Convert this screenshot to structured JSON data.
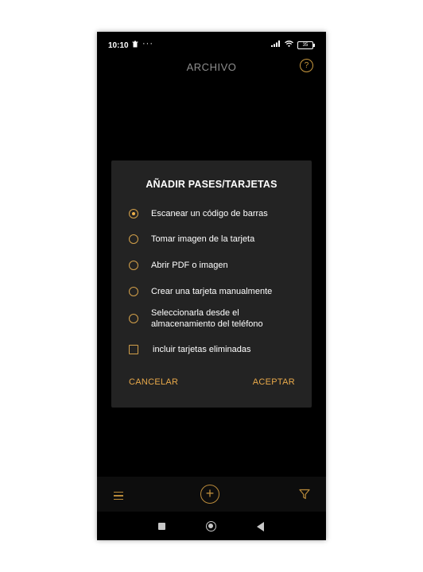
{
  "status_bar": {
    "time": "10:10",
    "dots": "···",
    "battery": "35"
  },
  "app_bar": {
    "title": "ARCHIVO",
    "help_glyph": "?"
  },
  "dialog": {
    "title": "AÑADIR PASES/TARJETAS",
    "options": [
      {
        "label": "Escanear un código de barras",
        "selected": true
      },
      {
        "label": "Tomar imagen de la tarjeta",
        "selected": false
      },
      {
        "label": "Abrir PDF o imagen",
        "selected": false
      },
      {
        "label": "Crear una tarjeta manualmente",
        "selected": false
      },
      {
        "label_line1": "Seleccionarla desde el",
        "label_line2": "almacenamiento del teléfono",
        "selected": false
      }
    ],
    "checkbox": {
      "label": "incluir tarjetas eliminadas",
      "checked": false
    },
    "cancel_label": "CANCELAR",
    "accept_label": "ACEPTAR"
  },
  "bottom_bar": {
    "add_glyph": "+"
  },
  "icons": [
    "trash-icon",
    "signal-icon",
    "wifi-icon",
    "battery-icon",
    "help-icon",
    "menu-icon",
    "add-icon",
    "filter-icon",
    "nav-recents-icon",
    "nav-home-icon",
    "nav-back-icon"
  ],
  "colors": {
    "accent": "#e8a94a",
    "background": "#000000",
    "dialog_bg": "#232323"
  }
}
